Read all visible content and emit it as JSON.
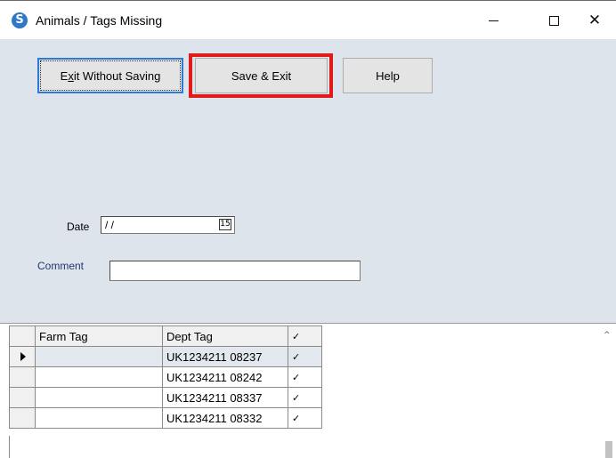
{
  "window": {
    "title": "Animals / Tags Missing",
    "app_icon_glyph": "S",
    "close_glyph": "✕"
  },
  "toolbar": {
    "exit_prefix": "E",
    "exit_underlined": "x",
    "exit_rest": "it Without Saving",
    "save_label": "Save & Exit",
    "help_label": "Help"
  },
  "form": {
    "date_label": "Date",
    "date_value": " / /",
    "calendar_glyph": "15",
    "comment_label": "Comment",
    "comment_value": ""
  },
  "grid": {
    "columns": [
      "Farm Tag",
      "Dept Tag",
      "✓"
    ],
    "rows": [
      {
        "farm_tag": "",
        "dept_tag": "UK1234211 08237",
        "check": "✓"
      },
      {
        "farm_tag": "",
        "dept_tag": "UK1234211 08242",
        "check": "✓"
      },
      {
        "farm_tag": "",
        "dept_tag": "UK1234211 08337",
        "check": "✓"
      },
      {
        "farm_tag": "",
        "dept_tag": "UK1234211 08332",
        "check": "✓"
      }
    ],
    "scroll_up_glyph": "^"
  },
  "colors": {
    "form_background": "#dde4ec",
    "highlight_border": "#e11a1a",
    "focus_border": "#2b7bd6"
  }
}
